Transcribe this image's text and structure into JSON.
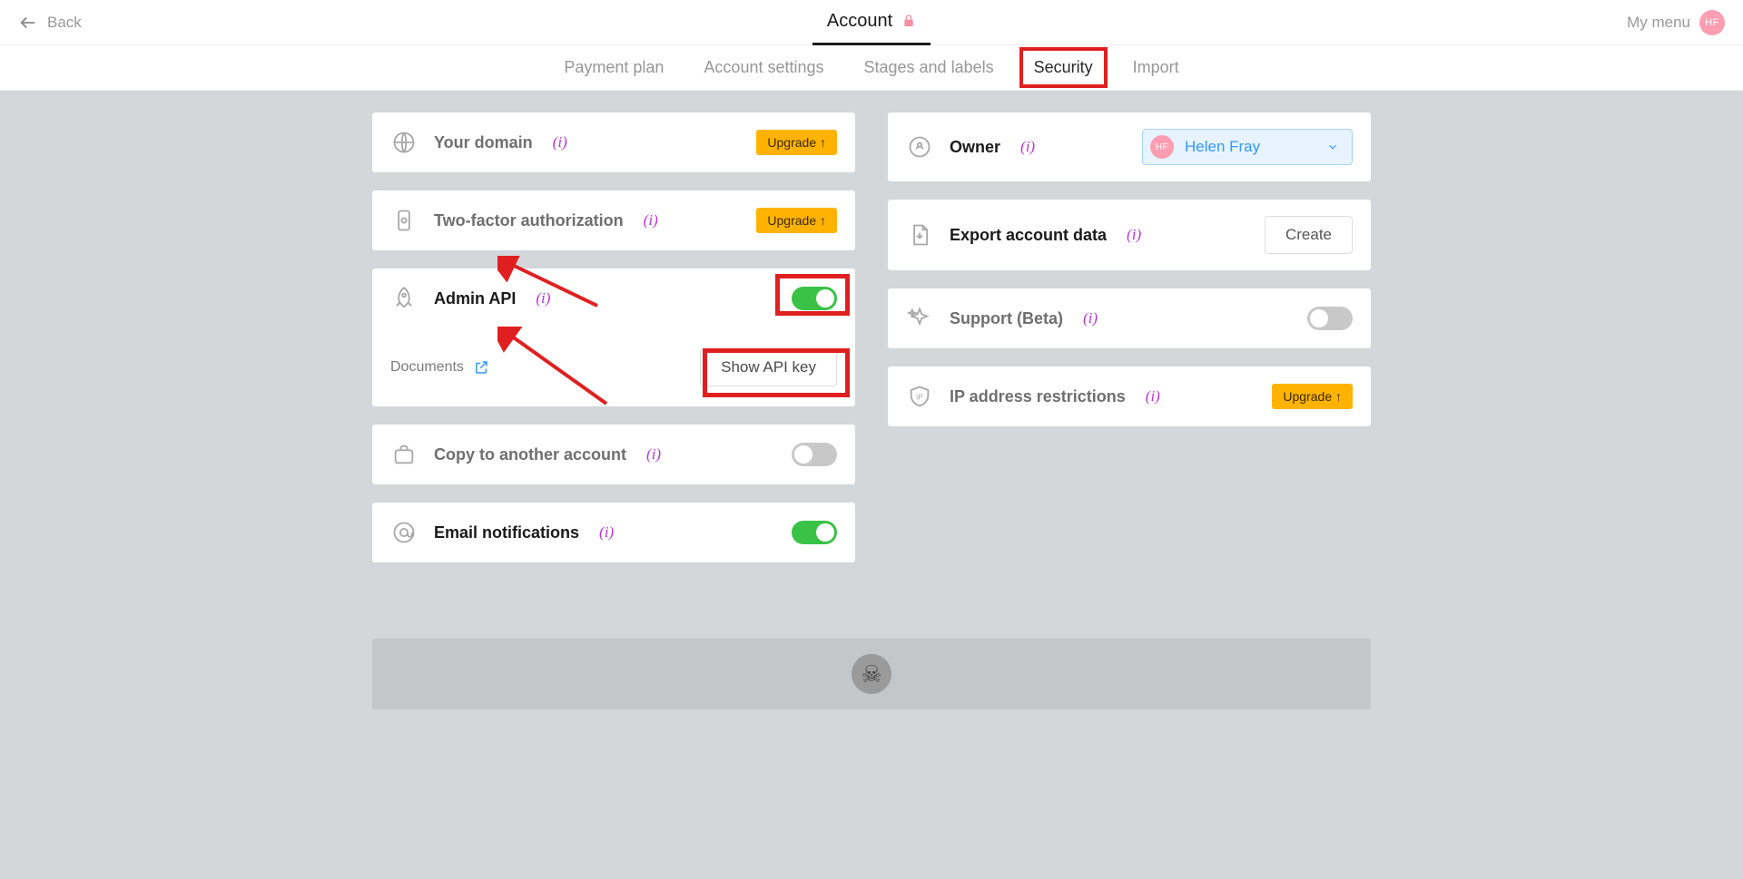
{
  "topbar": {
    "back": "Back",
    "title": "Account",
    "my_menu": "My menu",
    "avatar": "HF"
  },
  "tabs": {
    "payment": "Payment plan",
    "settings": "Account settings",
    "stages": "Stages and labels",
    "security": "Security",
    "import": "Import"
  },
  "left": {
    "domain": {
      "title": "Your domain",
      "info": "i",
      "upgrade": "Upgrade ↑"
    },
    "twofa": {
      "title": "Two-factor authorization",
      "info": "i",
      "upgrade": "Upgrade ↑"
    },
    "admin": {
      "title": "Admin API",
      "info": "i",
      "docs": "Documents",
      "show_key": "Show API key"
    },
    "copy": {
      "title": "Copy to another account",
      "info": "i"
    },
    "email": {
      "title": "Email notifications",
      "info": "i"
    }
  },
  "right": {
    "owner": {
      "title": "Owner",
      "info": "i",
      "name": "Helen Fray",
      "avatar": "HF"
    },
    "export": {
      "title": "Export account data",
      "info": "i",
      "create": "Create"
    },
    "support": {
      "title": "Support (Beta)",
      "info": "i"
    },
    "ip": {
      "title": "IP address restrictions",
      "info": "i",
      "upgrade": "Upgrade ↑"
    }
  },
  "danger": {
    "skull": "☠"
  }
}
